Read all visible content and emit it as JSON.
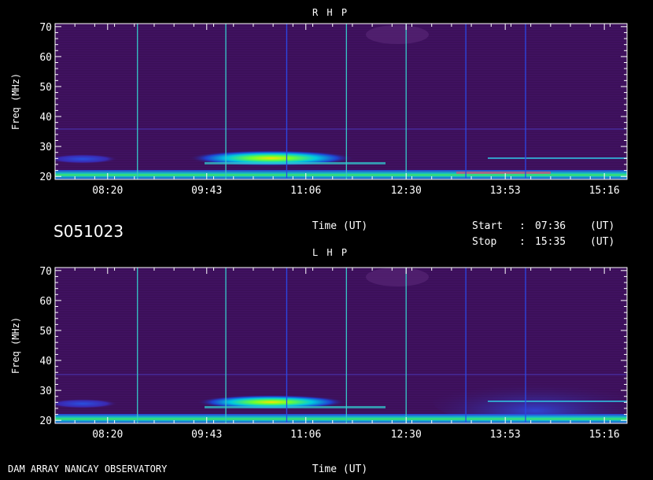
{
  "header_code": "S051023",
  "footer": "DAM ARRAY  NANCAY OBSERVATORY",
  "start": {
    "label": "Start",
    "sep": ":",
    "value": "07:36",
    "unit": "(UT)"
  },
  "stop": {
    "label": "Stop",
    "sep": ":",
    "value": "15:35",
    "unit": "(UT)"
  },
  "colors": {
    "background": "#3c105a",
    "marker_cyan": "#36c8c8",
    "marker_blue": "#2a48e6",
    "frame": "#ffffff"
  },
  "chart_data": [
    {
      "type": "heatmap",
      "title": "R H P",
      "xlabel": "Time (UT)",
      "ylabel": "Freq (MHz)",
      "ylim": [
        19,
        71
      ],
      "xlim": [
        "07:36",
        "15:35"
      ],
      "x_tick_labels": [
        "08:20",
        "09:43",
        "11:06",
        "12:30",
        "13:53",
        "15:16"
      ],
      "y_tick_labels": [
        "20",
        "30",
        "40",
        "50",
        "60",
        "70"
      ],
      "y_ticks": [
        20,
        30,
        40,
        50,
        60,
        70
      ],
      "time_markers": [
        {
          "time": "08:45",
          "color": "cyan"
        },
        {
          "time": "09:59",
          "color": "cyan"
        },
        {
          "time": "10:50",
          "color": "blue"
        },
        {
          "time": "11:40",
          "color": "cyan"
        },
        {
          "time": "12:30",
          "color": "cyan"
        },
        {
          "time": "13:20",
          "color": "blue"
        },
        {
          "time": "14:10",
          "color": "blue"
        }
      ],
      "emission": [
        {
          "t_start": "09:59",
          "t_end": "11:40",
          "f_low": 25,
          "f_high": 29,
          "peak_time": "10:50",
          "intensity": "high"
        },
        {
          "t_start": "07:36",
          "t_end": "08:30",
          "f_low": 24.5,
          "f_high": 27,
          "intensity": "medium"
        },
        {
          "t_start": "07:36",
          "t_end": "15:35",
          "f_low": 20,
          "f_high": 22.5,
          "intensity": "high"
        }
      ]
    },
    {
      "type": "heatmap",
      "title": "L H P",
      "xlabel": "Time (UT)",
      "ylabel": "Freq (MHz)",
      "ylim": [
        19,
        71
      ],
      "xlim": [
        "07:36",
        "15:35"
      ],
      "x_tick_labels": [
        "08:20",
        "09:43",
        "11:06",
        "12:30",
        "13:53",
        "15:16"
      ],
      "y_tick_labels": [
        "20",
        "30",
        "40",
        "50",
        "60",
        "70"
      ],
      "y_ticks": [
        20,
        30,
        40,
        50,
        60,
        70
      ],
      "time_markers": [
        {
          "time": "08:45",
          "color": "cyan"
        },
        {
          "time": "09:59",
          "color": "cyan"
        },
        {
          "time": "10:50",
          "color": "blue"
        },
        {
          "time": "11:40",
          "color": "cyan"
        },
        {
          "time": "12:30",
          "color": "cyan"
        },
        {
          "time": "13:20",
          "color": "blue"
        },
        {
          "time": "14:10",
          "color": "blue"
        }
      ],
      "emission": [
        {
          "t_start": "09:59",
          "t_end": "11:40",
          "f_low": 25,
          "f_high": 28.5,
          "peak_time": "10:50",
          "intensity": "high"
        },
        {
          "t_start": "07:36",
          "t_end": "08:30",
          "f_low": 24,
          "f_high": 27,
          "intensity": "medium"
        },
        {
          "t_start": "13:20",
          "t_end": "15:35",
          "f_low": 20,
          "f_high": 33,
          "intensity": "medium"
        },
        {
          "t_start": "07:36",
          "t_end": "15:35",
          "f_low": 20,
          "f_high": 22.5,
          "intensity": "high"
        }
      ]
    }
  ]
}
